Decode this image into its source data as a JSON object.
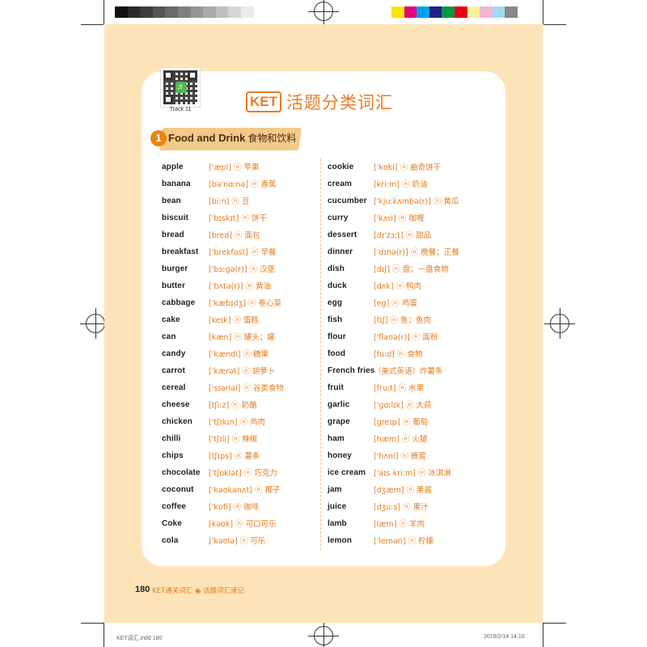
{
  "colors": {
    "accent": "#ea7b26",
    "page_bg": "#fde4b8",
    "banner": "#f3c98a",
    "gray_swatches": [
      "#111111",
      "#2a2a2a",
      "#3d3d3d",
      "#555555",
      "#6a6a6a",
      "#7f7f7f",
      "#959595",
      "#aaaaaa",
      "#c0c0c0",
      "#d5d5d5",
      "#ebebeb",
      "#ffffff"
    ],
    "color_swatches": [
      "#f9e400",
      "#e4007f",
      "#00a0e9",
      "#1d2088",
      "#009944",
      "#e60012",
      "#f8f29f",
      "#f4b4d0",
      "#a3d9f5",
      "#888888"
    ]
  },
  "qr": {
    "label": "Track 11",
    "icon": "speaker-icon"
  },
  "header": {
    "badge": "KET",
    "title": "活题分类词汇"
  },
  "section": {
    "number": "1",
    "title_en": "Food and Drink",
    "title_cn": "食物和饮料"
  },
  "left_column": [
    {
      "word": "apple",
      "def": "['æpl] ⓝ 苹果"
    },
    {
      "word": "banana",
      "def": "[bə'nɑːnə] ⓝ 香蕉"
    },
    {
      "word": "bean",
      "def": "[biːn] ⓝ 豆"
    },
    {
      "word": "biscuit",
      "def": "['bɪskɪt] ⓝ 饼干"
    },
    {
      "word": "bread",
      "def": "[bred] ⓝ 面包"
    },
    {
      "word": "breakfast",
      "def": "['brekfəst] ⓝ 早餐"
    },
    {
      "word": "burger",
      "def": "['bɜːgə(r)] ⓝ 汉堡"
    },
    {
      "word": "butter",
      "def": "['bʌtə(r)] ⓝ 黄油"
    },
    {
      "word": "cabbage",
      "def": "['kæbɪdʒ] ⓝ 卷心菜"
    },
    {
      "word": "cake",
      "def": "[keɪk] ⓝ 蛋糕"
    },
    {
      "word": "can",
      "def": "[kæn] ⓝ 罐头；罐"
    },
    {
      "word": "candy",
      "def": "['kændi] ⓝ 糖果"
    },
    {
      "word": "carrot",
      "def": "['kærət] ⓝ 胡萝卜"
    },
    {
      "word": "cereal",
      "def": "['sɪəriəl] ⓝ 谷类食物"
    },
    {
      "word": "cheese",
      "def": "[tʃiːz] ⓝ 奶酪"
    },
    {
      "word": "chicken",
      "def": "['tʃɪkɪn] ⓝ 鸡肉"
    },
    {
      "word": "chilli",
      "def": "['tʃɪli] ⓝ 辣椒"
    },
    {
      "word": "chips",
      "def": "[tʃɪps] ⓝ 薯条"
    },
    {
      "word": "chocolate",
      "def": "['tʃɒklət] ⓝ 巧克力"
    },
    {
      "word": "coconut",
      "def": "['kəʊkənʌt] ⓝ 椰子"
    },
    {
      "word": "coffee",
      "def": "['kɒfi] ⓝ 咖啡"
    },
    {
      "word": "Coke",
      "def": "[kəʊk] ⓝ 可口可乐"
    },
    {
      "word": "cola",
      "def": "['kəʊlə] ⓝ 可乐"
    }
  ],
  "right_column": [
    {
      "word": "cookie",
      "def": "['kʊki] ⓝ 曲奇饼干"
    },
    {
      "word": "cream",
      "def": "[kriːm] ⓝ 奶油"
    },
    {
      "word": "cucumber",
      "def": "['kjuːkʌmbə(r)] ⓝ 黄瓜"
    },
    {
      "word": "curry",
      "def": "['kʌri] ⓝ 咖喱"
    },
    {
      "word": "dessert",
      "def": "[dɪ'zɜːt] ⓝ 甜品"
    },
    {
      "word": "dinner",
      "def": "['dɪnə(r)] ⓝ 晚餐；正餐"
    },
    {
      "word": "dish",
      "def": "[dɪʃ] ⓝ 盘；一盘食物"
    },
    {
      "word": "duck",
      "def": "[dʌk] ⓝ 鸭肉"
    },
    {
      "word": "egg",
      "def": "[eg] ⓝ 鸡蛋"
    },
    {
      "word": "fish",
      "def": "[fɪʃ] ⓝ 鱼；鱼肉"
    },
    {
      "word": "flour",
      "def": "['flaʊə(r)] ⓝ 面粉"
    },
    {
      "word": "food",
      "def": "[fuːd] ⓝ 食物"
    },
    {
      "word": "French fries",
      "def": "（美式英语）炸薯条"
    },
    {
      "word": "fruit",
      "def": "[fruːt] ⓝ 水果"
    },
    {
      "word": "garlic",
      "def": "['gɑːlɪk] ⓝ 大蒜"
    },
    {
      "word": "grape",
      "def": "[greɪp] ⓝ 葡萄"
    },
    {
      "word": "ham",
      "def": "[hæm] ⓝ 火腿"
    },
    {
      "word": "honey",
      "def": "['hʌni] ⓝ 蜂蜜"
    },
    {
      "word": "ice cream",
      "def": "['aɪs kriːm] ⓝ 冰淇淋"
    },
    {
      "word": "jam",
      "def": "[dʒæm] ⓝ 果酱"
    },
    {
      "word": "juice",
      "def": "[dʒuːs] ⓝ 果汁"
    },
    {
      "word": "lamb",
      "def": "[læm] ⓝ 羊肉"
    },
    {
      "word": "lemon",
      "def": "['lemən] ⓝ 柠檬"
    }
  ],
  "footer": {
    "page_number": "180",
    "text": "KET通关词汇 ◉ 话题词汇速记"
  },
  "slug": {
    "left": "KET词汇.indd 180",
    "right": "2019/2/14 14:10"
  }
}
